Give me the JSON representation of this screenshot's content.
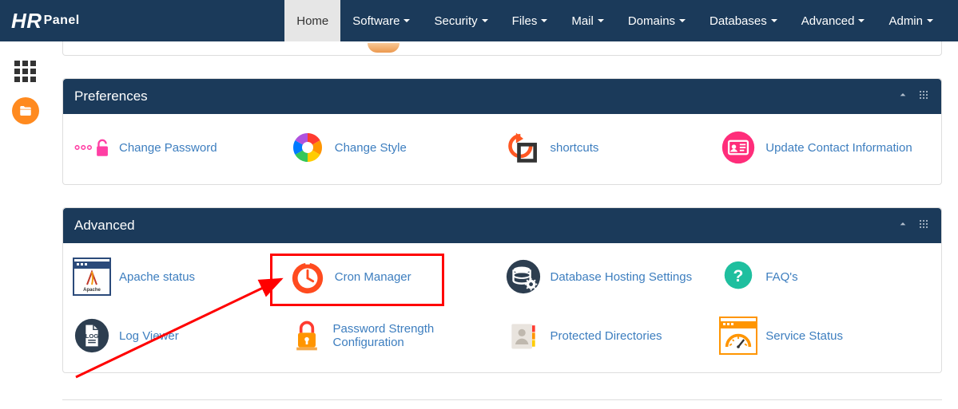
{
  "brand": {
    "hr": "HR",
    "panel": "Panel"
  },
  "nav": {
    "items": [
      {
        "label": "Home",
        "has_caret": false,
        "active": true
      },
      {
        "label": "Software",
        "has_caret": true,
        "active": false
      },
      {
        "label": "Security",
        "has_caret": true,
        "active": false
      },
      {
        "label": "Files",
        "has_caret": true,
        "active": false
      },
      {
        "label": "Mail",
        "has_caret": true,
        "active": false
      },
      {
        "label": "Domains",
        "has_caret": true,
        "active": false
      },
      {
        "label": "Databases",
        "has_caret": true,
        "active": false
      },
      {
        "label": "Advanced",
        "has_caret": true,
        "active": false
      },
      {
        "label": "Admin",
        "has_caret": true,
        "active": false
      }
    ]
  },
  "sections": {
    "preferences": {
      "title": "Preferences",
      "items": [
        {
          "label": "Change Password",
          "icon": "lock-pink"
        },
        {
          "label": "Change Style",
          "icon": "palette"
        },
        {
          "label": "shortcuts",
          "icon": "rotate-frame"
        },
        {
          "label": "Update Contact Information",
          "icon": "id-card"
        }
      ]
    },
    "advanced": {
      "title": "Advanced",
      "items": [
        {
          "label": "Apache status",
          "icon": "apache"
        },
        {
          "label": "Cron Manager",
          "icon": "stopwatch"
        },
        {
          "label": "Database Hosting Settings",
          "icon": "db-gear"
        },
        {
          "label": "FAQ's",
          "icon": "question"
        },
        {
          "label": "Log Viewer",
          "icon": "log"
        },
        {
          "label": "Password Strength Configuration",
          "icon": "lock-orange"
        },
        {
          "label": "Protected Directories",
          "icon": "contacts"
        },
        {
          "label": "Service Status",
          "icon": "gauge"
        }
      ]
    }
  },
  "annotation": {
    "highlight_target": "Cron Manager"
  }
}
